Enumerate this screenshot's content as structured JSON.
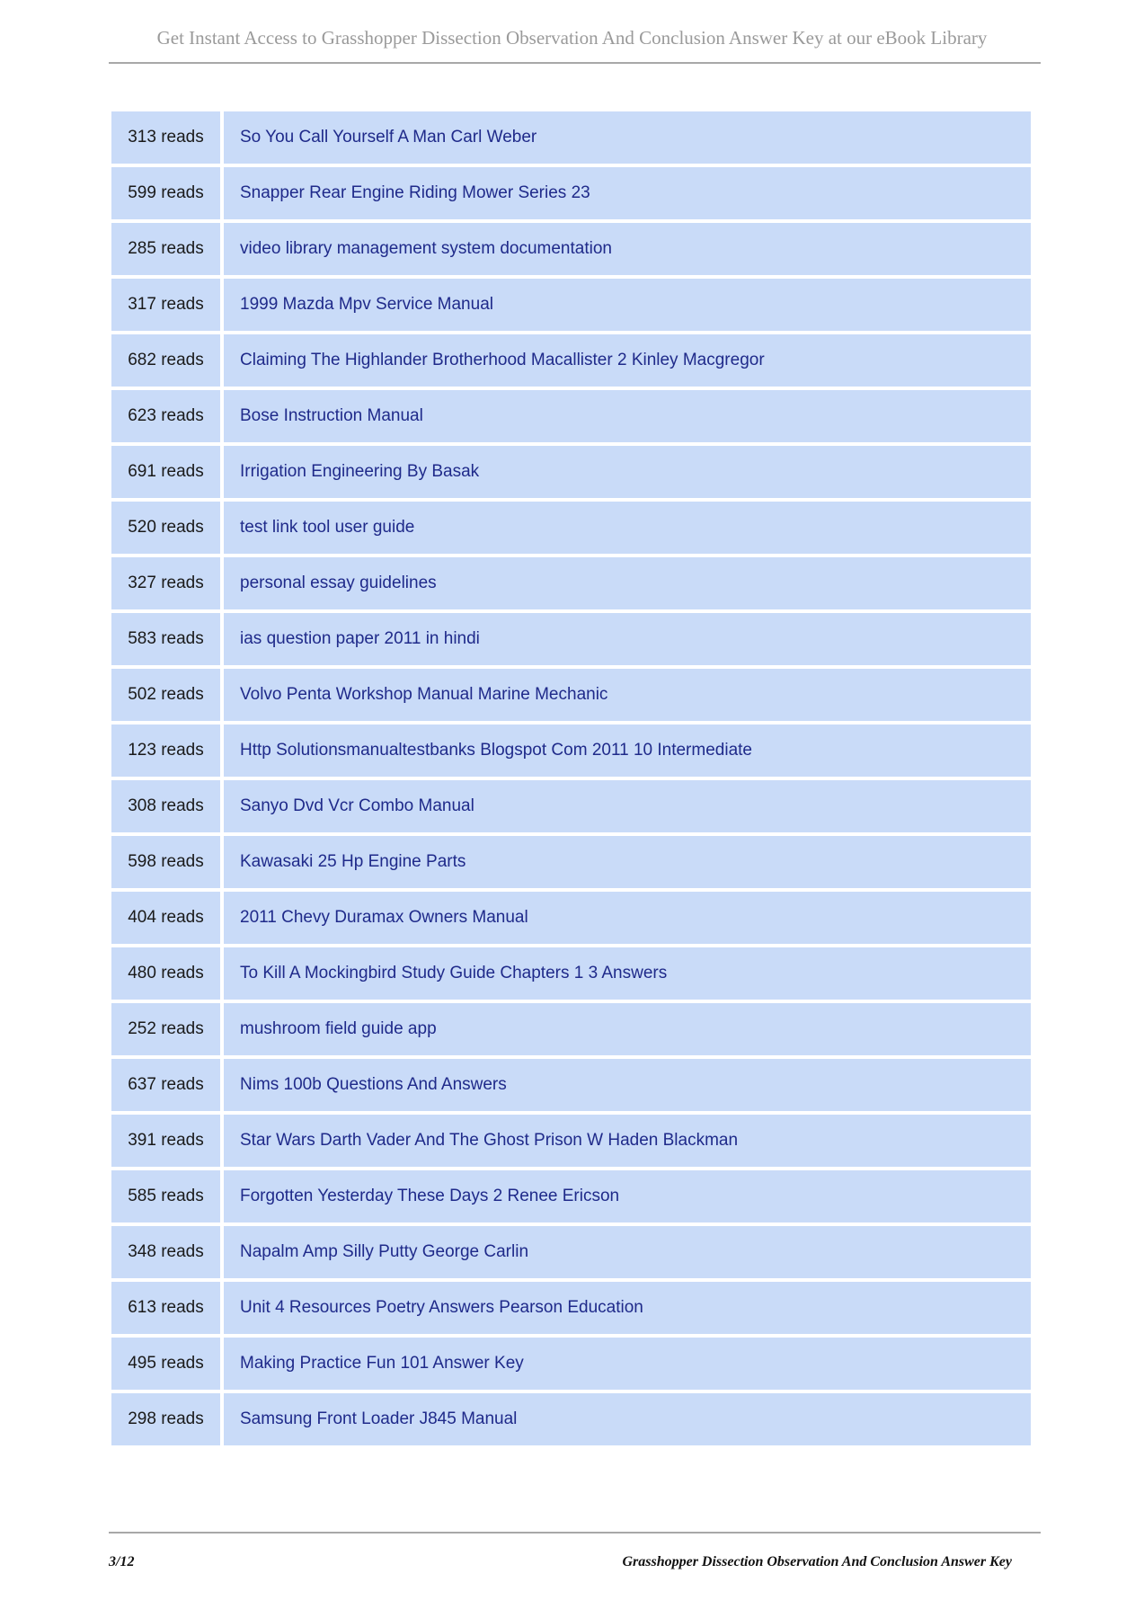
{
  "header": {
    "text": "Get Instant Access to Grasshopper Dissection Observation And Conclusion Answer Key at our eBook Library"
  },
  "table": {
    "rows": [
      {
        "reads": "313 reads",
        "title": "So You Call Yourself A Man Carl Weber"
      },
      {
        "reads": "599 reads",
        "title": "Snapper Rear Engine Riding Mower Series 23"
      },
      {
        "reads": "285 reads",
        "title": "video library management system documentation"
      },
      {
        "reads": "317 reads",
        "title": "1999 Mazda Mpv Service Manual"
      },
      {
        "reads": "682 reads",
        "title": "Claiming The Highlander Brotherhood Macallister 2 Kinley Macgregor"
      },
      {
        "reads": "623 reads",
        "title": "Bose Instruction Manual"
      },
      {
        "reads": "691 reads",
        "title": "Irrigation Engineering By Basak"
      },
      {
        "reads": "520 reads",
        "title": "test link tool user guide"
      },
      {
        "reads": "327 reads",
        "title": "personal essay guidelines"
      },
      {
        "reads": "583 reads",
        "title": "ias question paper 2011 in hindi"
      },
      {
        "reads": "502 reads",
        "title": "Volvo Penta Workshop Manual Marine Mechanic"
      },
      {
        "reads": "123 reads",
        "title": "Http Solutionsmanualtestbanks Blogspot Com 2011 10 Intermediate"
      },
      {
        "reads": "308 reads",
        "title": "Sanyo Dvd Vcr Combo Manual"
      },
      {
        "reads": "598 reads",
        "title": "Kawasaki 25 Hp Engine Parts"
      },
      {
        "reads": "404 reads",
        "title": "2011 Chevy Duramax Owners Manual"
      },
      {
        "reads": "480 reads",
        "title": "To Kill A Mockingbird Study Guide Chapters 1 3 Answers"
      },
      {
        "reads": "252 reads",
        "title": "mushroom field guide app"
      },
      {
        "reads": "637 reads",
        "title": "Nims 100b Questions And Answers"
      },
      {
        "reads": "391 reads",
        "title": "Star Wars Darth Vader And The Ghost Prison W Haden Blackman"
      },
      {
        "reads": "585 reads",
        "title": "Forgotten Yesterday These Days 2 Renee Ericson"
      },
      {
        "reads": "348 reads",
        "title": "Napalm Amp Silly Putty George Carlin"
      },
      {
        "reads": "613 reads",
        "title": "Unit 4 Resources Poetry Answers Pearson Education"
      },
      {
        "reads": "495 reads",
        "title": "Making Practice Fun 101 Answer Key"
      },
      {
        "reads": "298 reads",
        "title": "Samsung Front Loader J845 Manual"
      }
    ]
  },
  "footer": {
    "page": "3/12",
    "title": "Grasshopper Dissection Observation And Conclusion Answer Key"
  },
  "colors": {
    "cell_bg": "#c9dbf8",
    "link": "#1f2a8a",
    "header_text": "#9a9a9a"
  }
}
